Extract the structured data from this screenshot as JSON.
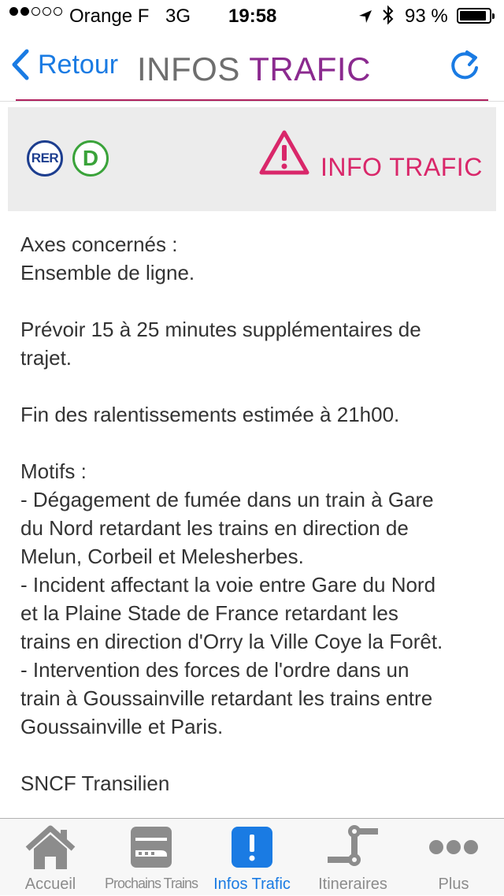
{
  "status_bar": {
    "carrier": "Orange F",
    "network": "3G",
    "time": "19:58",
    "battery_text": "93 %",
    "battery_level": 0.93
  },
  "nav": {
    "back_label": "Retour",
    "title_part1": "INFOS",
    "title_part2": "TRAFIC"
  },
  "banner": {
    "network_badge": "RER",
    "line_badge": "D",
    "label": "INFO TRAFIC"
  },
  "message": {
    "lines": [
      "Axes concernés :",
      "Ensemble de ligne.",
      "",
      "Prévoir 15 à 25 minutes supplémentaires de",
      "trajet.",
      "",
      "Fin des ralentissements estimée à 21h00.",
      "",
      "Motifs :",
      "- Dégagement de fumée dans un train à Gare",
      "du Nord retardant les trains en direction de",
      "Melun, Corbeil et Melesherbes.",
      "- Incident affectant la voie entre Gare du Nord",
      "et la Plaine Stade de France retardant les",
      "trains en direction d'Orry la Ville Coye la Forêt.",
      "- Intervention des forces de l'ordre dans un",
      "train à Goussainville retardant les trains entre",
      "Goussainville et Paris.",
      "",
      "SNCF Transilien"
    ]
  },
  "tabs": [
    {
      "label": "Accueil",
      "icon": "house-icon"
    },
    {
      "label": "Prochains Trains",
      "icon": "train-icon"
    },
    {
      "label": "Infos Trafic",
      "icon": "exclamation-icon"
    },
    {
      "label": "Itineraires",
      "icon": "route-icon"
    },
    {
      "label": "Plus",
      "icon": "more-icon"
    }
  ],
  "colors": {
    "accent_blue": "#1a7be3",
    "title_purple": "#8b2a8f",
    "alert_pink": "#d9276a",
    "rer_blue": "#1d3e8f",
    "line_d_green": "#3aa33a"
  }
}
